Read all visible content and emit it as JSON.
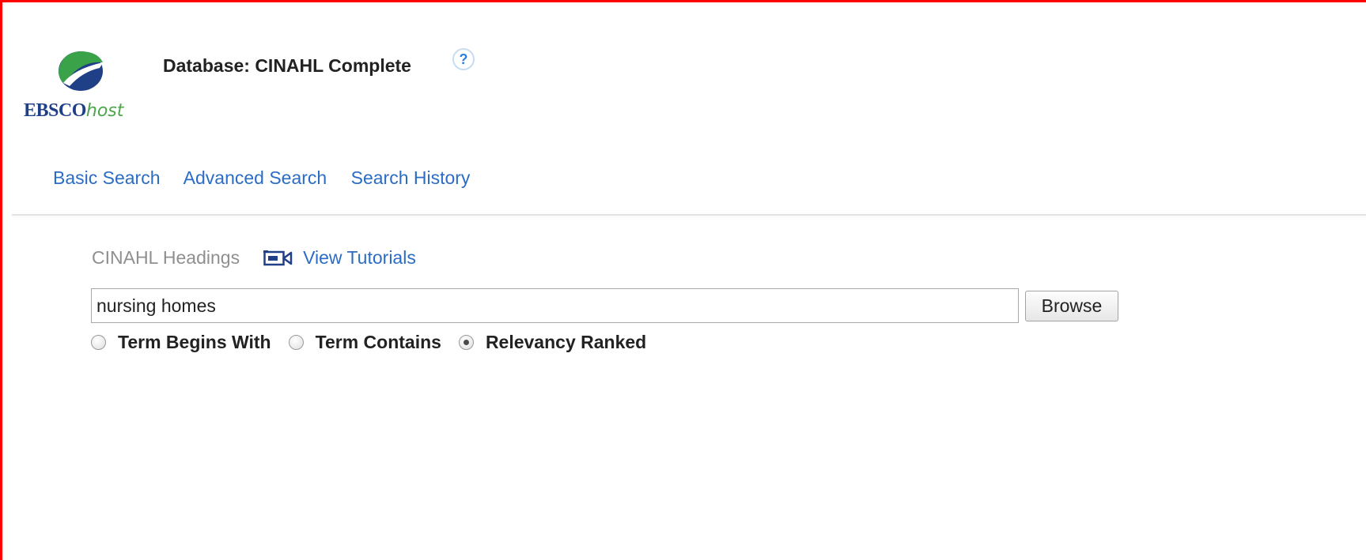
{
  "header": {
    "logo": {
      "brand": "EBSCO",
      "brand_suffix": "host",
      "icon": "ebsco-globe-logo"
    },
    "database_title": "Database: CINAHL Complete",
    "help_icon_glyph": "?"
  },
  "nav": {
    "items": [
      {
        "label": "Basic Search"
      },
      {
        "label": "Advanced Search"
      },
      {
        "label": "Search History"
      }
    ]
  },
  "browse": {
    "headings_label": "CINAHL Headings",
    "tutorials_icon": "video-camera-icon",
    "tutorials_label": "View Tutorials",
    "search_value": "nursing homes",
    "browse_button_label": "Browse",
    "options": [
      {
        "label": "Term Begins With",
        "checked": false
      },
      {
        "label": "Term Contains",
        "checked": false
      },
      {
        "label": "Relevancy Ranked",
        "checked": true
      }
    ]
  },
  "colors": {
    "link": "#2b6cc4",
    "frame_border": "#ff0000",
    "logo_blue": "#1f3f87",
    "logo_green": "#4ba54b"
  }
}
